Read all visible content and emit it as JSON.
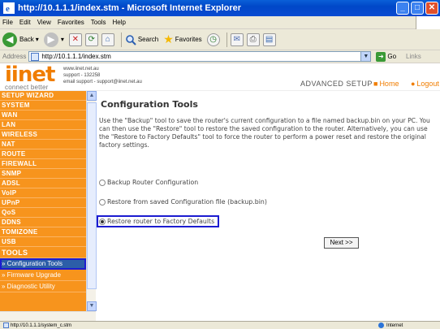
{
  "window": {
    "title": "http://10.1.1.1/index.stm - Microsoft Internet Explorer"
  },
  "menu": [
    "File",
    "Edit",
    "View",
    "Favorites",
    "Tools",
    "Help"
  ],
  "toolbar": {
    "back": "Back",
    "search": "Search",
    "favorites": "Favorites"
  },
  "address": {
    "label": "Address",
    "url": "http://10.1.1.1/index.stm",
    "go": "Go",
    "links": "Links"
  },
  "header": {
    "logo": "iinet",
    "tagline": "connect better",
    "contact": [
      "www.iinet.net.au",
      "support - 132258",
      "email support - support@iinet.net.au"
    ],
    "section": "ADVANCED SETUP",
    "links": [
      "Home",
      "Logout"
    ]
  },
  "sidebar": {
    "items": [
      "SETUP WIZARD",
      "SYSTEM",
      "WAN",
      "LAN",
      "WIRELESS",
      "NAT",
      "ROUTE",
      "FIREWALL",
      "SNMP",
      "ADSL",
      "VoIP",
      "UPnP",
      "QoS",
      "DDNS",
      "TOMIZONE",
      "USB"
    ],
    "tools_heading": "TOOLS",
    "sub_items": [
      "» Configuration Tools",
      "» Firmware Upgrade",
      "» Diagnostic Utility"
    ],
    "active_sub": "» Configuration Tools"
  },
  "main": {
    "title": "Configuration Tools",
    "description": "Use the \"Backup\" tool to save the router's current configuration to a file named backup.bin on your PC. You can then use the \"Restore\" tool to restore the saved configuration to the router. Alternatively, you can use the \"Restore to Factory Defaults\" tool to force the router to perform a power reset and restore the original factory settings.",
    "options": [
      "Backup Router Configuration",
      "Restore from saved Configuration file (backup.bin)",
      "Restore router to Factory Defaults"
    ],
    "selected_option": "Restore router to Factory Defaults",
    "next_label": "Next >>"
  },
  "status": {
    "url": "http://10.1.1.1/system_c.stm",
    "zone": "Internet"
  },
  "colors": {
    "brand_orange": "#f7941d",
    "title_blue": "#0047c8",
    "highlight": "#1c1cd0"
  }
}
